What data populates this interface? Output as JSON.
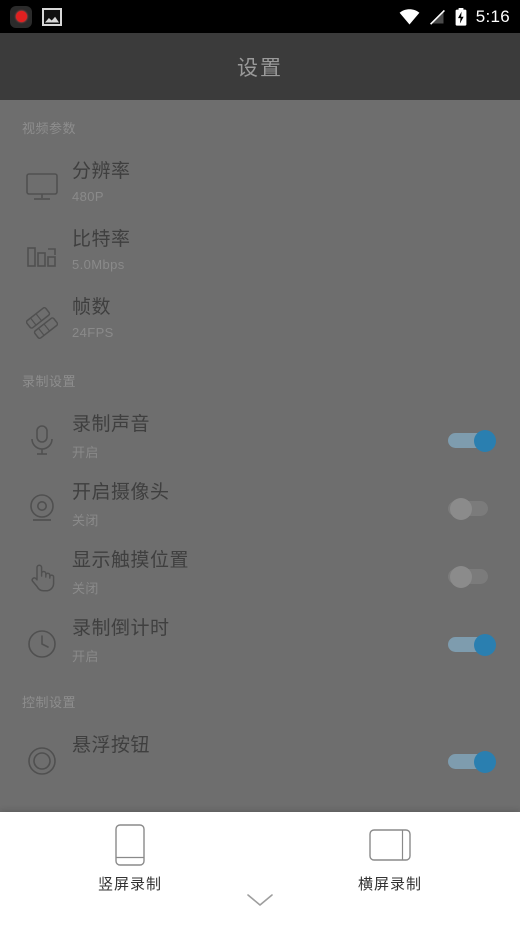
{
  "status_bar": {
    "left_icons": [
      "screen-recorder-icon",
      "gallery-icon"
    ],
    "right_icons": [
      "wifi-icon",
      "signal-icon",
      "battery-charging-icon"
    ],
    "time": "5:16"
  },
  "toolbar": {
    "title": "设置"
  },
  "settings": {
    "sections": [
      {
        "header": "视频参数",
        "rows": [
          {
            "icon": "monitor-icon",
            "title": "分辨率",
            "value": "480P",
            "control": "none"
          },
          {
            "icon": "bitrate-icon",
            "title": "比特率",
            "value": "5.0Mbps",
            "control": "none"
          },
          {
            "icon": "filmstrip-icon",
            "title": "帧数",
            "value": "24FPS",
            "control": "none"
          }
        ]
      },
      {
        "header": "录制设置",
        "rows": [
          {
            "icon": "microphone-icon",
            "title": "录制声音",
            "value": "开启",
            "control": "switch",
            "state": "on"
          },
          {
            "icon": "webcam-icon",
            "title": "开启摄像头",
            "value": "关闭",
            "control": "switch",
            "state": "off"
          },
          {
            "icon": "touch-hand-icon",
            "title": "显示触摸位置",
            "value": "关闭",
            "control": "switch",
            "state": "off"
          },
          {
            "icon": "clock-icon",
            "title": "录制倒计时",
            "value": "开启",
            "control": "switch",
            "state": "on"
          }
        ]
      },
      {
        "header": "控制设置",
        "rows": [
          {
            "icon": "floating-button-icon",
            "title": "悬浮按钮",
            "value": "",
            "control": "switch",
            "state": "on"
          }
        ]
      }
    ]
  },
  "bottom_sheet": {
    "options": [
      {
        "icon": "phone-portrait-icon",
        "label": "竖屏录制"
      },
      {
        "icon": "phone-landscape-icon",
        "label": "横屏录制"
      }
    ],
    "collapse_icon": "chevron-down-icon"
  },
  "colors": {
    "status_bar_bg": "#000000",
    "toolbar_bg": "#3b3b3b",
    "scrim_bg": "#6e6e6e",
    "sheet_bg": "#ffffff",
    "switch_on_thumb": "#2a7fb0",
    "switch_on_track": "#7e9cae",
    "switch_off_thumb": "#8b8b8b",
    "record_red": "#e02020",
    "title_text": "#3f3f3f",
    "subtitle_text": "#8a8a8a"
  }
}
